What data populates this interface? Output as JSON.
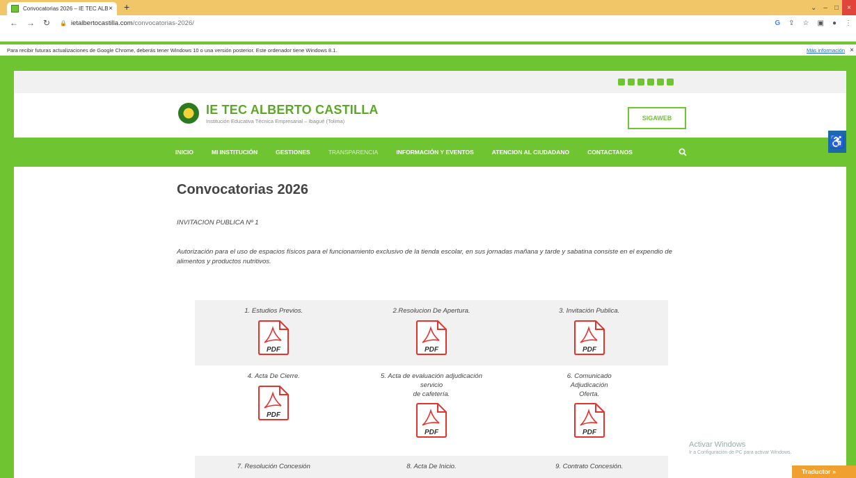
{
  "browser": {
    "tab_title": "Convocatorias 2026 – IE TEC ALB",
    "tab_close": "×",
    "new_tab": "+",
    "url_domain": "ietalbertocastilla.com",
    "url_path": "/convocatorias-2026/",
    "win_min": "–",
    "win_max": "□",
    "win_close": "×",
    "chevron": "⌄"
  },
  "infobar": {
    "message": "Para recibir futuras actualizaciones de Google Chrome, deberás tener Windows 10 o una versión posterior. Este ordenador tiene Windows 8.1.",
    "link": "Más información",
    "close": "×"
  },
  "site": {
    "name": "IE TEC ALBERTO CASTILLA",
    "subtitle": "Institución Educativa Técnica Empresarial – Ibagué (Tolima)",
    "sigaweb": "SIGAWEB"
  },
  "menu": {
    "items": [
      "INICIO",
      "MI INSTITUCIÓN",
      "GESTIONES",
      "TRANSPARENCIA",
      "INFORMACIÓN Y EVENTOS",
      "ATENCION AL CIUDADANO",
      "CONTACTANOS"
    ]
  },
  "page": {
    "title": "Convocatorias 2026",
    "invitation": "INVITACION PUBLICA Nº 1",
    "description": "Autorización para el uso de espacios físicos para el funcionamiento exclusivo de la tienda escolar, en sus jornadas mañana y tarde y sabatina consiste en el expendio de alimentos y productos nutritivos."
  },
  "documents": {
    "pdf_label": "PDF",
    "row1": [
      {
        "lines": [
          "1. Estudios Previos."
        ]
      },
      {
        "lines": [
          "2.Resolucion De Apertura."
        ]
      },
      {
        "lines": [
          "3. Invitación Publica."
        ]
      }
    ],
    "row2": [
      {
        "lines": [
          "4. Acta De Cierre."
        ]
      },
      {
        "lines": [
          "5. Acta de evaluación  adjudicación",
          "servicio",
          "de cafetería."
        ]
      },
      {
        "lines": [
          "6. Comunicado",
          "Adjudicación",
          "Oferta."
        ]
      }
    ],
    "row3": [
      {
        "lines": [
          "7. Resolución Concesión"
        ]
      },
      {
        "lines": [
          "8. Acta De Inicio."
        ]
      },
      {
        "lines": [
          "9. Contrato Concesión."
        ]
      }
    ]
  },
  "system": {
    "activate_title": "Activar Windows",
    "activate_sub": "Ir a Configuración de PC para activar Windows.",
    "translator": "Traductor »"
  },
  "colors": {
    "brand_green": "#6ec431",
    "pdf_red": "#e5322d"
  }
}
